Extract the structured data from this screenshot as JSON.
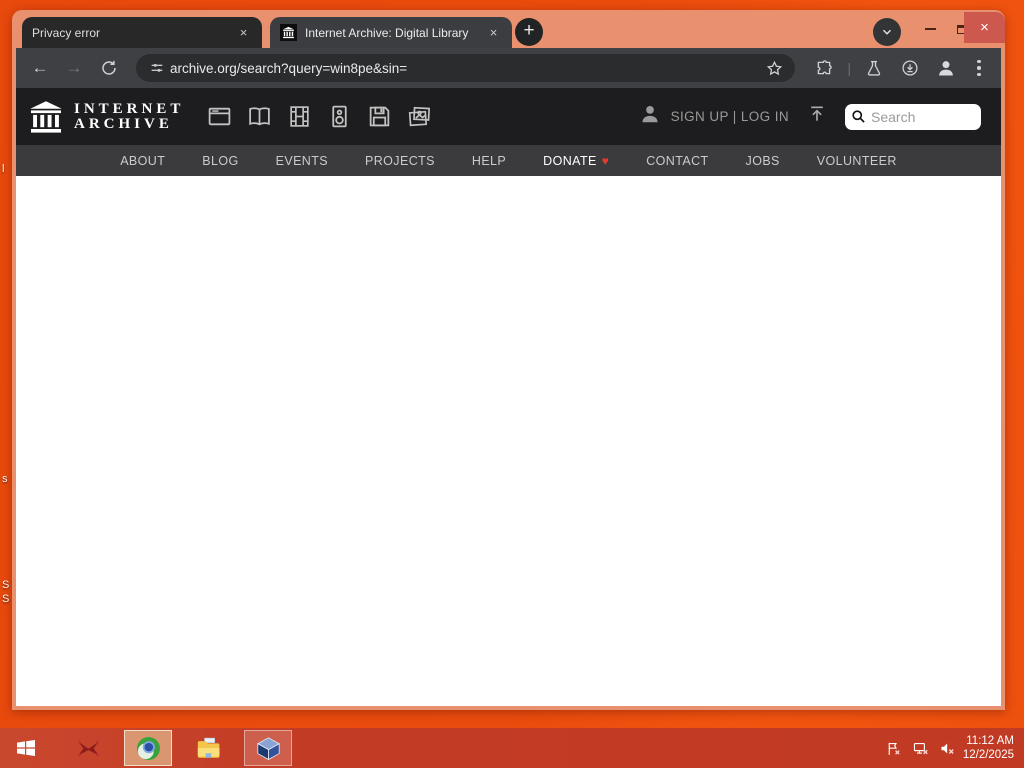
{
  "icons": {
    "plus": "+",
    "close": "×",
    "back": "←",
    "forward": "→",
    "separator": "|",
    "heart": "♥"
  },
  "colors": {
    "desktop": "#ea4c0d",
    "window_frame": "#e9916f",
    "browser_chrome": "#3f4043",
    "close_button": "#cd584e",
    "taskbar": "#c23b24",
    "ia_header": "#1d1d1f",
    "ia_nav": "#3b3b3d",
    "donate_heart": "#e63b2e"
  },
  "browser": {
    "tabs": [
      {
        "title": "Privacy error"
      },
      {
        "title": "Internet Archive: Digital Library"
      }
    ],
    "url": "archive.org/search?query=win8pe&sin="
  },
  "ia": {
    "logo_line1": "INTERNET",
    "logo_line2": "ARCHIVE",
    "account_text": "SIGN UP | LOG IN",
    "search_placeholder": "Search",
    "nav": [
      "ABOUT",
      "BLOG",
      "EVENTS",
      "PROJECTS",
      "HELP",
      "DONATE",
      "CONTACT",
      "JOBS",
      "VOLUNTEER"
    ],
    "media_types": [
      "web",
      "texts",
      "video",
      "audio",
      "software",
      "images"
    ]
  },
  "desktop": {
    "label_fragments": [
      "l",
      "s",
      "S",
      "S"
    ]
  },
  "taskbar": {
    "time": "11:12 AM",
    "date": "12/2/2025"
  }
}
